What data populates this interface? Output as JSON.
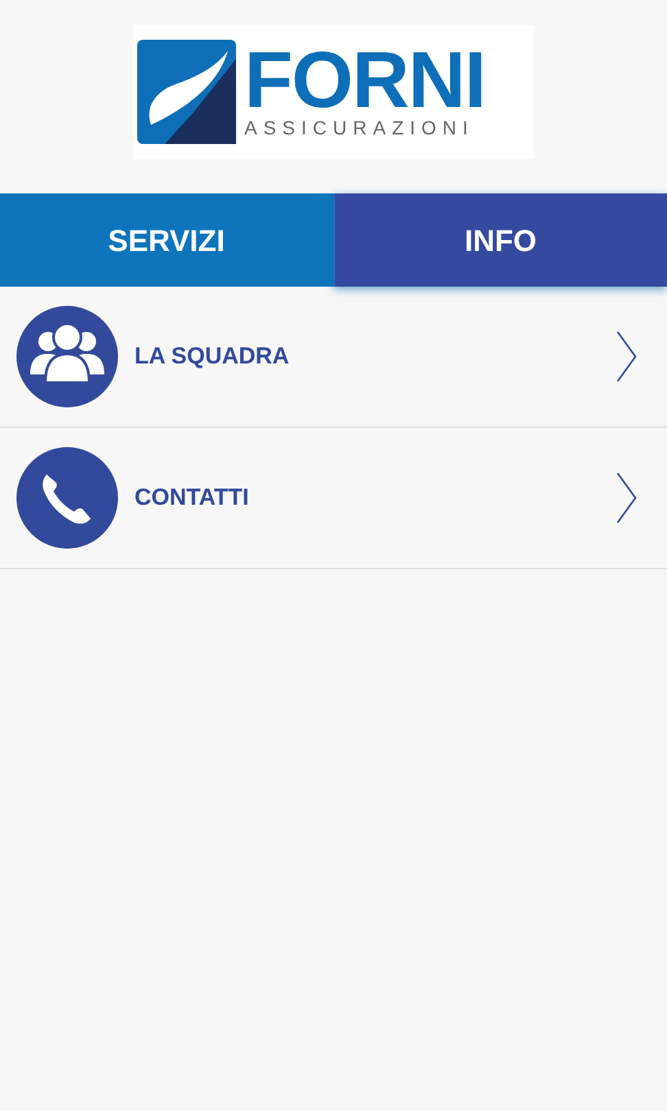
{
  "logo": {
    "name": "FORNI",
    "tagline": "ASSICURAZIONI"
  },
  "tabs": [
    {
      "label": "SERVIZI",
      "selected": false
    },
    {
      "label": "INFO",
      "selected": true
    }
  ],
  "items": [
    {
      "kind": "team",
      "label": "LA SQUADRA"
    },
    {
      "kind": "phone",
      "label": "CONTATTI"
    }
  ]
}
